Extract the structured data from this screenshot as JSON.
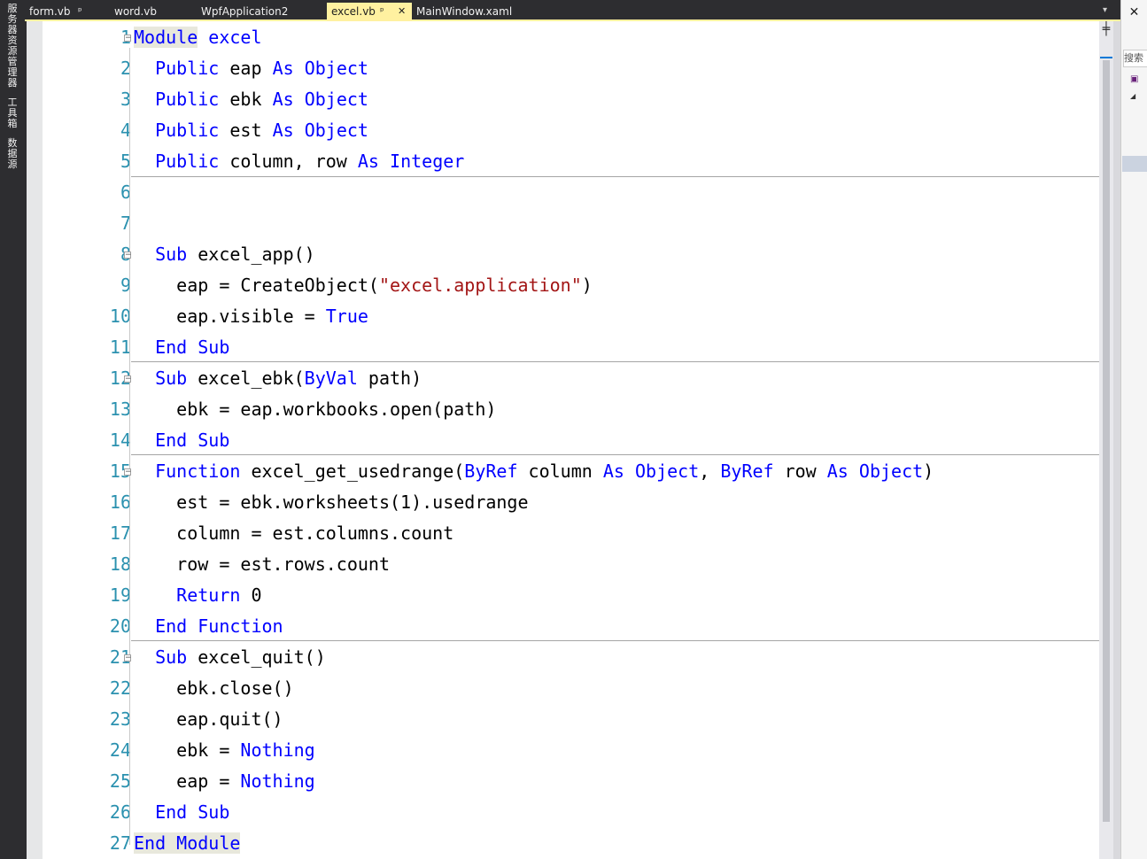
{
  "left_strip": {
    "items": [
      "服务器资源管理器",
      "工具箱",
      "数据源"
    ]
  },
  "tabs": [
    {
      "label": "form.vb",
      "glyph": "ᵖ",
      "active": false
    },
    {
      "label": "word.vb",
      "glyph": "",
      "active": false
    },
    {
      "label": "WpfApplication2",
      "glyph": "",
      "active": false
    },
    {
      "label": "excel.vb",
      "glyph": "ᵖ",
      "active": true,
      "close": "✕"
    },
    {
      "label": "MainWindow.xaml",
      "glyph": "",
      "active": false
    }
  ],
  "tab_dropdown": "▾",
  "editor": {
    "line_numbers": [
      "1",
      "2",
      "3",
      "4",
      "5",
      "6",
      "7",
      "8",
      "9",
      "10",
      "11",
      "12",
      "13",
      "14",
      "15",
      "16",
      "17",
      "18",
      "19",
      "20",
      "21",
      "22",
      "23",
      "24",
      "25",
      "26",
      "27"
    ],
    "lines": [
      [
        {
          "t": "Module",
          "c": "kw hl"
        },
        {
          "t": " "
        },
        {
          "t": "excel",
          "c": "kw"
        }
      ],
      [
        {
          "t": "  "
        },
        {
          "t": "Public",
          "c": "kw"
        },
        {
          "t": " eap "
        },
        {
          "t": "As",
          "c": "kw"
        },
        {
          "t": " "
        },
        {
          "t": "Object",
          "c": "kw"
        }
      ],
      [
        {
          "t": "  "
        },
        {
          "t": "Public",
          "c": "kw"
        },
        {
          "t": " ebk "
        },
        {
          "t": "As",
          "c": "kw"
        },
        {
          "t": " "
        },
        {
          "t": "Object",
          "c": "kw"
        }
      ],
      [
        {
          "t": "  "
        },
        {
          "t": "Public",
          "c": "kw"
        },
        {
          "t": " est "
        },
        {
          "t": "As",
          "c": "kw"
        },
        {
          "t": " "
        },
        {
          "t": "Object",
          "c": "kw"
        }
      ],
      [
        {
          "t": "  "
        },
        {
          "t": "Public",
          "c": "kw"
        },
        {
          "t": " column, row "
        },
        {
          "t": "As",
          "c": "kw"
        },
        {
          "t": " "
        },
        {
          "t": "Integer",
          "c": "kw"
        }
      ],
      [],
      [],
      [
        {
          "t": "  "
        },
        {
          "t": "Sub",
          "c": "kw"
        },
        {
          "t": " excel_app()"
        }
      ],
      [
        {
          "t": "    eap = CreateObject("
        },
        {
          "t": "\"excel.application\"",
          "c": "str"
        },
        {
          "t": ")"
        }
      ],
      [
        {
          "t": "    eap.visible = "
        },
        {
          "t": "True",
          "c": "kw"
        }
      ],
      [
        {
          "t": "  "
        },
        {
          "t": "End",
          "c": "kw"
        },
        {
          "t": " "
        },
        {
          "t": "Sub",
          "c": "kw"
        }
      ],
      [
        {
          "t": "  "
        },
        {
          "t": "Sub",
          "c": "kw"
        },
        {
          "t": " excel_ebk("
        },
        {
          "t": "ByVal",
          "c": "kw"
        },
        {
          "t": " path)"
        }
      ],
      [
        {
          "t": "    ebk = eap.workbooks.open(path)"
        }
      ],
      [
        {
          "t": "  "
        },
        {
          "t": "End",
          "c": "kw"
        },
        {
          "t": " "
        },
        {
          "t": "Sub",
          "c": "kw"
        }
      ],
      [
        {
          "t": "  "
        },
        {
          "t": "Function",
          "c": "kw"
        },
        {
          "t": " excel_get_usedrange("
        },
        {
          "t": "ByRef",
          "c": "kw"
        },
        {
          "t": " column "
        },
        {
          "t": "As",
          "c": "kw"
        },
        {
          "t": " "
        },
        {
          "t": "Object",
          "c": "kw"
        },
        {
          "t": ", "
        },
        {
          "t": "ByRef",
          "c": "kw"
        },
        {
          "t": " row "
        },
        {
          "t": "As",
          "c": "kw"
        },
        {
          "t": " "
        },
        {
          "t": "Object",
          "c": "kw"
        },
        {
          "t": ")"
        }
      ],
      [
        {
          "t": "    est = ebk.worksheets(1).usedrange"
        }
      ],
      [
        {
          "t": "    column = est.columns.count"
        }
      ],
      [
        {
          "t": "    row = est.rows.count"
        }
      ],
      [
        {
          "t": "    "
        },
        {
          "t": "Return",
          "c": "kw"
        },
        {
          "t": " 0"
        }
      ],
      [
        {
          "t": "  "
        },
        {
          "t": "End",
          "c": "kw"
        },
        {
          "t": " "
        },
        {
          "t": "Function",
          "c": "kw"
        }
      ],
      [
        {
          "t": "  "
        },
        {
          "t": "Sub",
          "c": "kw"
        },
        {
          "t": " excel_quit()"
        }
      ],
      [
        {
          "t": "    ebk.close()"
        }
      ],
      [
        {
          "t": "    eap.quit()"
        }
      ],
      [
        {
          "t": "    ebk = "
        },
        {
          "t": "Nothing",
          "c": "kw"
        }
      ],
      [
        {
          "t": "    eap = "
        },
        {
          "t": "Nothing",
          "c": "kw"
        }
      ],
      [
        {
          "t": "  "
        },
        {
          "t": "End",
          "c": "kw"
        },
        {
          "t": " "
        },
        {
          "t": "Sub",
          "c": "kw"
        }
      ],
      [
        {
          "t": "End Module",
          "c": "kw hl"
        }
      ]
    ],
    "fold_marker": "⊟"
  },
  "scrollbar": {
    "split_glyph": "╪"
  },
  "right_panel": {
    "close": "✕",
    "search_label": "搜索",
    "icon": "vb-file-icon",
    "arrow": "◢"
  },
  "colors": {
    "keyword": "#0000ff",
    "string": "#a31515",
    "line_number": "#2b91af",
    "active_tab": "#fff1a0"
  }
}
